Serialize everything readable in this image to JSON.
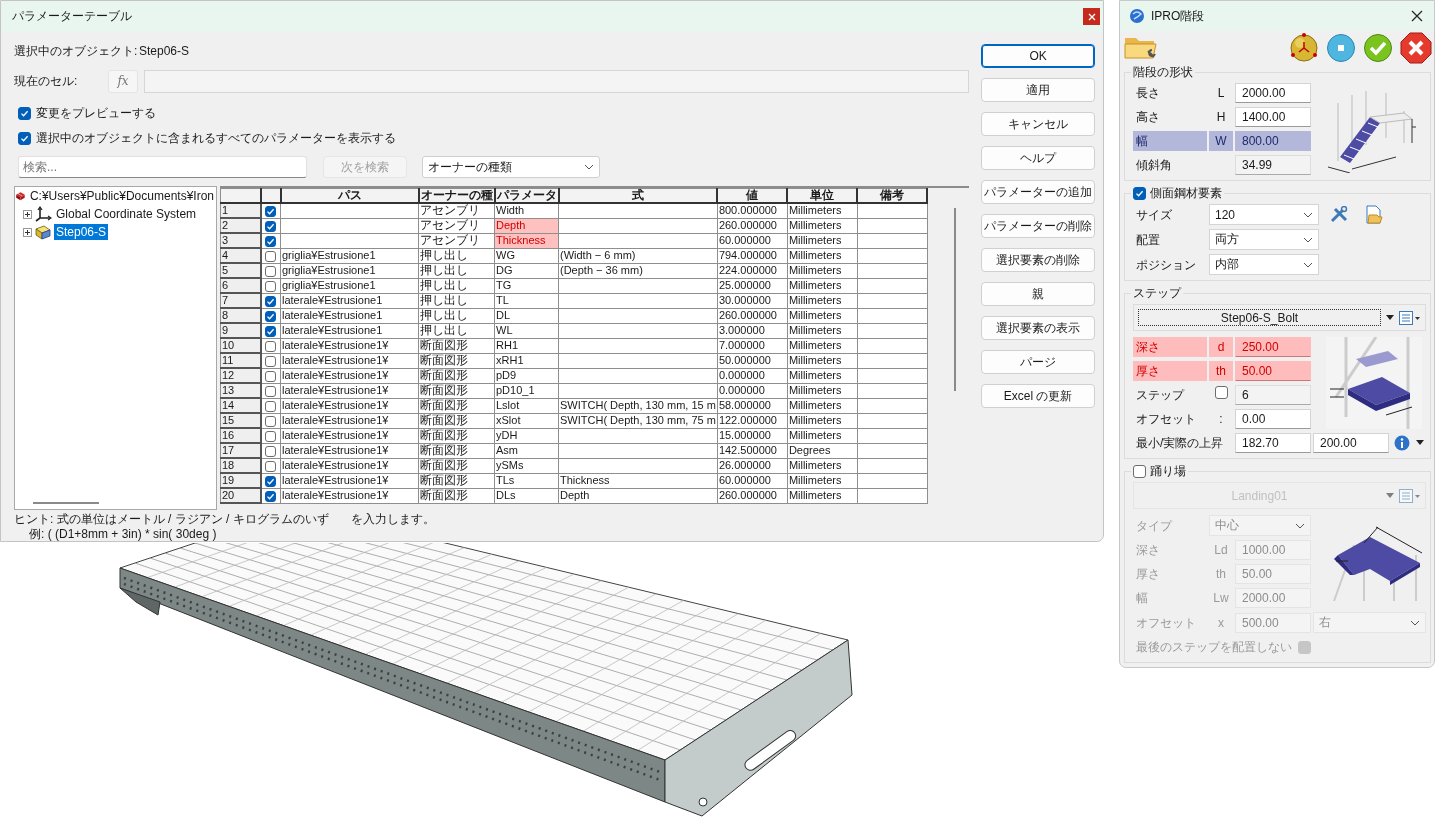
{
  "parameter_dialog": {
    "title": "パラメーターテーブル",
    "selected_object_label": "選択中のオブジェクト:",
    "selected_object": "Step06-S",
    "current_cell_label": "現在のセル:",
    "fx_button": "fx",
    "options": [
      {
        "label": "変更をプレビューする",
        "checked": true
      },
      {
        "label": "選択中のオブジェクトに含まれるすべてのパラメーターを表示する",
        "checked": true
      }
    ],
    "search": {
      "placeholder": "検索..."
    },
    "find_next": {
      "label": "次を検索",
      "disabled": true
    },
    "owner_filter": {
      "value": "オーナーの種類"
    },
    "tree": [
      {
        "label": "C:¥Users¥Public¥Documents¥Iron",
        "kind": "file",
        "selected": false,
        "children": [
          {
            "label": "Global Coordinate System",
            "kind": "axes",
            "expanded": false,
            "selected": false
          },
          {
            "label": "Step06-S",
            "kind": "part",
            "expanded": false,
            "selected": true
          }
        ]
      }
    ],
    "table": {
      "columns": [
        "パス",
        "オーナーの種",
        "パラメータ",
        "式",
        "値",
        "単位",
        "備考"
      ],
      "rows": [
        {
          "n": "1",
          "checked": true,
          "owner": "アセンブリ",
          "param": "Width",
          "param_error": false,
          "value": "800.000000",
          "unit": "Millimeters"
        },
        {
          "n": "2",
          "checked": true,
          "owner": "アセンブリ",
          "param": "Depth",
          "param_error": true,
          "value": "260.000000",
          "unit": "Millimeters"
        },
        {
          "n": "3",
          "checked": true,
          "owner": "アセンブリ",
          "param": "Thickness",
          "param_error": true,
          "value": "60.000000",
          "unit": "Millimeters"
        },
        {
          "n": "4",
          "checked": false,
          "path": "griglia¥Estrusione1",
          "owner": "押し出し",
          "param": "WG",
          "param_error": false,
          "formula": "(Width − 6 mm)",
          "value": "794.000000",
          "unit": "Millimeters"
        },
        {
          "n": "5",
          "checked": false,
          "path": "griglia¥Estrusione1",
          "owner": "押し出し",
          "param": "DG",
          "param_error": false,
          "formula": "(Depth − 36 mm)",
          "value": "224.000000",
          "unit": "Millimeters"
        },
        {
          "n": "6",
          "checked": false,
          "path": "griglia¥Estrusione1",
          "owner": "押し出し",
          "param": "TG",
          "param_error": false,
          "value": "25.000000",
          "unit": "Millimeters"
        },
        {
          "n": "7",
          "checked": true,
          "path": "laterale¥Estrusione1",
          "owner": "押し出し",
          "param": "TL",
          "param_error": false,
          "value": "30.000000",
          "unit": "Millimeters"
        },
        {
          "n": "8",
          "checked": true,
          "path": "laterale¥Estrusione1",
          "owner": "押し出し",
          "param": "DL",
          "param_error": false,
          "value": "260.000000",
          "unit": "Millimeters"
        },
        {
          "n": "9",
          "checked": true,
          "path": "laterale¥Estrusione1",
          "owner": "押し出し",
          "param": "WL",
          "param_error": false,
          "value": "3.000000",
          "unit": "Millimeters"
        },
        {
          "n": "10",
          "checked": false,
          "path": "laterale¥Estrusione1¥",
          "owner": "断面図形",
          "param": "RH1",
          "param_error": false,
          "value": "7.000000",
          "unit": "Millimeters"
        },
        {
          "n": "11",
          "checked": false,
          "path": "laterale¥Estrusione1¥",
          "owner": "断面図形",
          "param": "xRH1",
          "param_error": false,
          "value": "50.000000",
          "unit": "Millimeters"
        },
        {
          "n": "12",
          "checked": false,
          "path": "laterale¥Estrusione1¥",
          "owner": "断面図形",
          "param": "pD9",
          "param_error": false,
          "value": "0.000000",
          "unit": "Millimeters"
        },
        {
          "n": "13",
          "checked": false,
          "path": "laterale¥Estrusione1¥",
          "owner": "断面図形",
          "param": "pD10_1",
          "param_error": false,
          "value": "0.000000",
          "unit": "Millimeters"
        },
        {
          "n": "14",
          "checked": false,
          "path": "laterale¥Estrusione1¥",
          "owner": "断面図形",
          "param": "Lslot",
          "param_error": false,
          "formula": "SWITCH( Depth, 130 mm, 15 m",
          "value": "58.000000",
          "unit": "Millimeters"
        },
        {
          "n": "15",
          "checked": false,
          "path": "laterale¥Estrusione1¥",
          "owner": "断面図形",
          "param": "xSlot",
          "param_error": false,
          "formula": "SWITCH( Depth, 130 mm, 75 m",
          "value": "122.000000",
          "unit": "Millimeters"
        },
        {
          "n": "16",
          "checked": false,
          "path": "laterale¥Estrusione1¥",
          "owner": "断面図形",
          "param": "yDH",
          "param_error": false,
          "value": "15.000000",
          "unit": "Millimeters"
        },
        {
          "n": "17",
          "checked": false,
          "path": "laterale¥Estrusione1¥",
          "owner": "断面図形",
          "param": "Asm",
          "param_error": false,
          "value": "142.500000",
          "unit": "Degrees"
        },
        {
          "n": "18",
          "checked": false,
          "path": "laterale¥Estrusione1¥",
          "owner": "断面図形",
          "param": "ySMs",
          "param_error": false,
          "value": "26.000000",
          "unit": "Millimeters"
        },
        {
          "n": "19",
          "checked": true,
          "path": "laterale¥Estrusione1¥",
          "owner": "断面図形",
          "param": "TLs",
          "param_error": false,
          "formula": "Thickness",
          "value": "60.000000",
          "unit": "Millimeters"
        },
        {
          "n": "20",
          "checked": true,
          "path": "laterale¥Estrusione1¥",
          "owner": "断面図形",
          "param": "DLs",
          "param_error": false,
          "formula": "Depth",
          "value": "260.000000",
          "unit": "Millimeters"
        }
      ]
    },
    "buttons": [
      {
        "label": "OK",
        "default": true
      },
      {
        "label": "適用",
        "default": false
      },
      {
        "label": "キャンセル",
        "default": false
      },
      {
        "label": "ヘルプ",
        "default": false
      },
      {
        "label": "パラメーターの追加",
        "default": false
      },
      {
        "label": "パラメーターの削除",
        "default": false
      },
      {
        "label": "選択要素の削除",
        "default": false
      },
      {
        "label": "親",
        "default": false
      },
      {
        "label": "選択要素の表示",
        "default": false
      },
      {
        "label": "パージ",
        "default": false
      },
      {
        "label": "Excel の更新",
        "default": false
      }
    ],
    "hint": {
      "line_1a": "ヒント: 式の単位はメートル / ラジアン / キログラムのいず",
      "line_1b": "を入力します。",
      "line_2": "例: ( (D1+8mm + 3in) * sin( 30deg )"
    }
  },
  "stairs_panel": {
    "title": "IPRO階段",
    "groups": [
      {
        "title": "階段の形状",
        "kind": "shape",
        "rows": [
          {
            "kind": "input",
            "label": "長さ",
            "symbol": "L",
            "value": "2000.00",
            "selected": false,
            "error": false,
            "readonly": false
          },
          {
            "kind": "input",
            "label": "高さ",
            "symbol": "H",
            "value": "1400.00",
            "selected": false,
            "error": false,
            "readonly": false
          },
          {
            "kind": "input",
            "label": "幅",
            "symbol": "W",
            "value": "800.00",
            "selected": true,
            "error": false,
            "readonly": false
          },
          {
            "kind": "input",
            "label": "傾斜角",
            "value": "34.99",
            "selected": false,
            "error": false,
            "readonly": true
          }
        ]
      },
      {
        "title": "側面鋼材要素",
        "kind": "profile",
        "checked": true,
        "rows": [
          {
            "kind": "select",
            "label": "サイズ",
            "value": "120",
            "tools": true
          },
          {
            "kind": "select",
            "label": "配置",
            "value": "両方",
            "tools": false
          },
          {
            "kind": "select",
            "label": "ポジション",
            "value": "内部",
            "tools": false
          }
        ]
      },
      {
        "title": "ステップ",
        "kind": "step",
        "selector": "Step06-S_Bolt",
        "rows": [
          {
            "kind": "input",
            "label": "深さ",
            "symbol": "d",
            "value": "250.00",
            "selected": false,
            "error": true,
            "readonly": false
          },
          {
            "kind": "input",
            "label": "厚さ",
            "symbol": "th",
            "value": "50.00",
            "selected": false,
            "error": true,
            "readonly": false
          },
          {
            "kind": "check_input",
            "label": "ステップ",
            "checked": false,
            "value": "6",
            "readonly": true
          },
          {
            "kind": "input",
            "label": "オフセット",
            "symbol": ":",
            "value": "0.00",
            "selected": false,
            "error": false,
            "readonly": false
          },
          {
            "kind": "pair",
            "label": "最小/実際の上昇",
            "value": "182.70",
            "value_2": "200.00"
          }
        ]
      },
      {
        "title": "踊り場",
        "kind": "landing",
        "checked": false,
        "selector": "Landing01",
        "rows": [
          {
            "kind": "select",
            "label": "タイプ",
            "value": "中心",
            "tools": false
          },
          {
            "kind": "input",
            "label": "深さ",
            "symbol": "Ld",
            "value": "1000.00",
            "selected": false,
            "error": false,
            "readonly": false
          },
          {
            "kind": "input",
            "label": "厚さ",
            "symbol": "th",
            "value": "50.00",
            "selected": false,
            "error": false,
            "readonly": false
          },
          {
            "kind": "input",
            "label": "幅",
            "symbol": "Lw",
            "value": "2000.00",
            "selected": false,
            "error": false,
            "readonly": false
          },
          {
            "kind": "input_select",
            "label": "オフセット",
            "symbol": "x",
            "value": "500.00",
            "option": "右"
          },
          {
            "kind": "check",
            "label": "最後のステップを配置しない",
            "checked": true
          }
        ]
      }
    ]
  }
}
